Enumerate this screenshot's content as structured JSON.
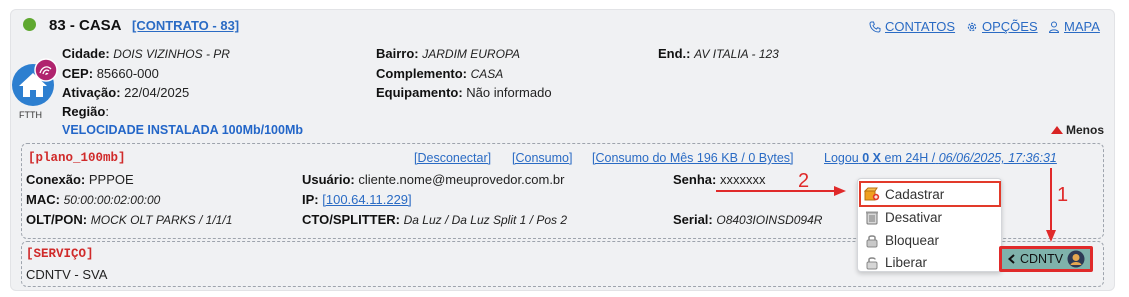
{
  "header": {
    "title": "83 - CASA",
    "contract_link": "[CONTRATO - 83]",
    "links": {
      "contacts": "CONTATOS",
      "options": "OPÇÕES",
      "map": "MAPA"
    }
  },
  "address": {
    "city_label": "Cidade:",
    "city": "DOIS VIZINHOS - PR",
    "cep_label": "CEP:",
    "cep": "85660-000",
    "activation_label": "Ativação:",
    "activation": "22/04/2025",
    "region_label": "Região",
    "region_sep": ":",
    "district_label": "Bairro:",
    "district": "JARDIM EUROPA",
    "complement_label": "Complemento:",
    "complement": "CASA",
    "equipment_label": "Equipamento:",
    "equipment": "Não informado",
    "end_label": "End.:",
    "end": "AV ITALIA - 123",
    "connection_type": "FTTH",
    "speed": "VELOCIDADE INSTALADA 100Mb/100Mb",
    "less_label": "Menos"
  },
  "plan": {
    "name": "[plano_100mb]",
    "links": {
      "disconnect": "[Desconectar]",
      "consumption": "[Consumo]",
      "month_consumption": "[Consumo do Mês 196 KB / 0 Bytes]"
    },
    "logged": {
      "prefix": "Logou",
      "count": "0 X",
      "mid": "em 24H /",
      "datetime": "06/06/2025, 17:36:31"
    },
    "connection_label": "Conexão:",
    "connection": "PPPOE",
    "mac_label": "MAC:",
    "mac": "50:00:00:02:00:00",
    "oltpon_label": "OLT/PON:",
    "oltpon": "MOCK OLT PARKS / 1/1/1",
    "user_label": "Usuário:",
    "user": "cliente.nome@meuprovedor.com.br",
    "ip_label": "IP:",
    "ip": "[100.64.11.229]",
    "cto_label": "CTO/SPLITTER:",
    "cto": "Da Luz / Da Luz Split 1 / Pos 2",
    "password_label": "Senha:",
    "password": "xxxxxxx",
    "serial_label": "Serial:",
    "serial": "O8403IOINSD094R"
  },
  "service": {
    "title": "[SERVIÇO]",
    "name": "CDNTV - SVA",
    "button_label": "CDNTV"
  },
  "menu": {
    "items": [
      "Cadastrar",
      "Desativar",
      "Bloquear",
      "Liberar"
    ]
  },
  "annotations": {
    "step1": "1",
    "step2": "2"
  },
  "colors": {
    "link": "#2a6bc4",
    "status_dot": "#5fa830",
    "label_red": "#d02a2a",
    "speed": "#2366c8",
    "highlight": "#e02a2a",
    "cdntv_bg": "#7fb2ab",
    "house": "#2d7fd0"
  }
}
